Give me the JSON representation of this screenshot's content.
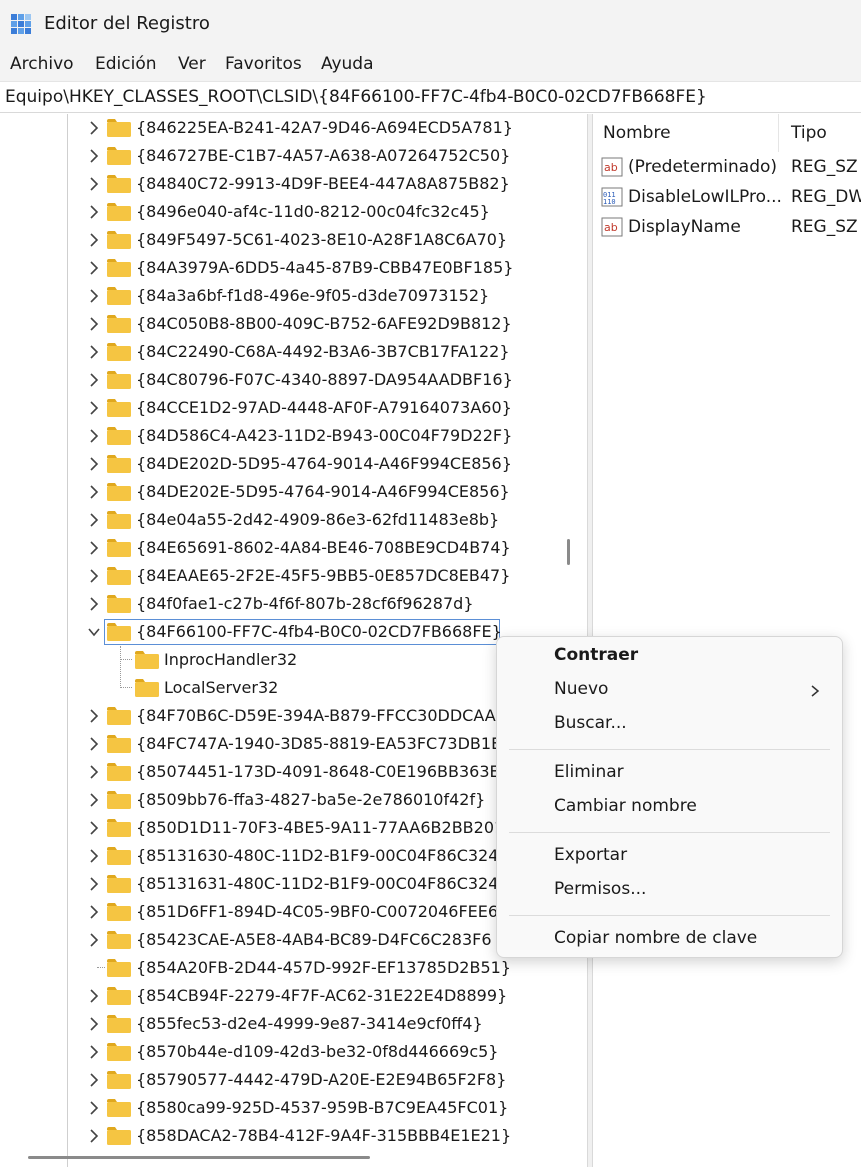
{
  "window": {
    "title": "Editor del Registro"
  },
  "menu": [
    "Archivo",
    "Edición",
    "Ver",
    "Favoritos",
    "Ayuda"
  ],
  "address": "Equipo\\HKEY_CLASSES_ROOT\\CLSID\\{84F66100-FF7C-4fb4-B0C0-02CD7FB668FE}",
  "tree": {
    "keys": [
      "{846225EA-B241-42A7-9D46-A694ECD5A781}",
      "{846727BE-C1B7-4A57-A638-A07264752C50}",
      "{84840C72-9913-4D9F-BEE4-447A8A875B82}",
      "{8496e040-af4c-11d0-8212-00c04fc32c45}",
      "{849F5497-5C61-4023-8E10-A28F1A8C6A70}",
      "{84A3979A-6DD5-4a45-87B9-CBB47E0BF185}",
      "{84a3a6bf-f1d8-496e-9f05-d3de70973152}",
      "{84C050B8-8B00-409C-B752-6AFE92D9B812}",
      "{84C22490-C68A-4492-B3A6-3B7CB17FA122}",
      "{84C80796-F07C-4340-8897-DA954AADBF16}",
      "{84CCE1D2-97AD-4448-AF0F-A79164073A60}",
      "{84D586C4-A423-11D2-B943-00C04F79D22F}",
      "{84DE202D-5D95-4764-9014-A46F994CE856}",
      "{84DE202E-5D95-4764-9014-A46F994CE856}",
      "{84e04a55-2d42-4909-86e3-62fd11483e8b}",
      "{84E65691-8602-4A84-BE46-708BE9CD4B74}",
      "{84EAAE65-2F2E-45F5-9BB5-0E857DC8EB47}",
      "{84f0fae1-c27b-4f6f-807b-28cf6f96287d}"
    ],
    "selected_key": "{84F66100-FF7C-4fb4-B0C0-02CD7FB668FE}",
    "subkeys": [
      "InprocHandler32",
      "LocalServer32"
    ],
    "keys_after": [
      "{84F70B6C-D59E-394A-B879-FFCC30DDCAA",
      "{84FC747A-1940-3D85-8819-EA53FC73DB1E",
      "{85074451-173D-4091-8648-C0E196BB363E}",
      "{8509bb76-ffa3-4827-ba5e-2e786010f42f}",
      "{850D1D11-70F3-4BE5-9A11-77AA6B2BB201",
      "{85131630-480C-11D2-B1F9-00C04F86C324}",
      "{85131631-480C-11D2-B1F9-00C04F86C324}",
      "{851D6FF1-894D-4C05-9BF0-C0072046FEE6}",
      "{85423CAE-A5E8-4AB4-BC89-D4FC6C283F6",
      "{854A20FB-2D44-457D-992F-EF13785D2B51}",
      "{854CB94F-2279-4F7F-AC62-31E22E4D8899}",
      "{855fec53-d2e4-4999-9e87-3414e9cf0ff4}",
      "{8570b44e-d109-42d3-be32-0f8d446669c5}",
      "{85790577-4442-479D-A20E-E2E94B65F2F8}",
      "{8580ca99-925D-4537-959B-B7C9EA45FC01}",
      "{858DACA2-78B4-412F-9A4F-315BBB4E1E21}"
    ]
  },
  "values": {
    "headers": {
      "name": "Nombre",
      "type": "Tipo"
    },
    "rows": [
      {
        "name": "(Predeterminado)",
        "type": "REG_SZ",
        "icon": "string-value-icon"
      },
      {
        "name": "DisableLowILPro...",
        "type": "REG_DW",
        "icon": "binary-value-icon"
      },
      {
        "name": "DisplayName",
        "type": "REG_SZ",
        "icon": "string-value-icon"
      }
    ]
  },
  "context_menu": {
    "collapse": "Contraer",
    "new": "Nuevo",
    "find": "Buscar...",
    "delete": "Eliminar",
    "rename": "Cambiar nombre",
    "export": "Exportar",
    "permissions": "Permisos...",
    "copy_key_name": "Copiar nombre de clave"
  },
  "colors": {
    "folder": "#f5c542",
    "folder_dark": "#e0a81e",
    "accent": "#5b8fd6"
  }
}
